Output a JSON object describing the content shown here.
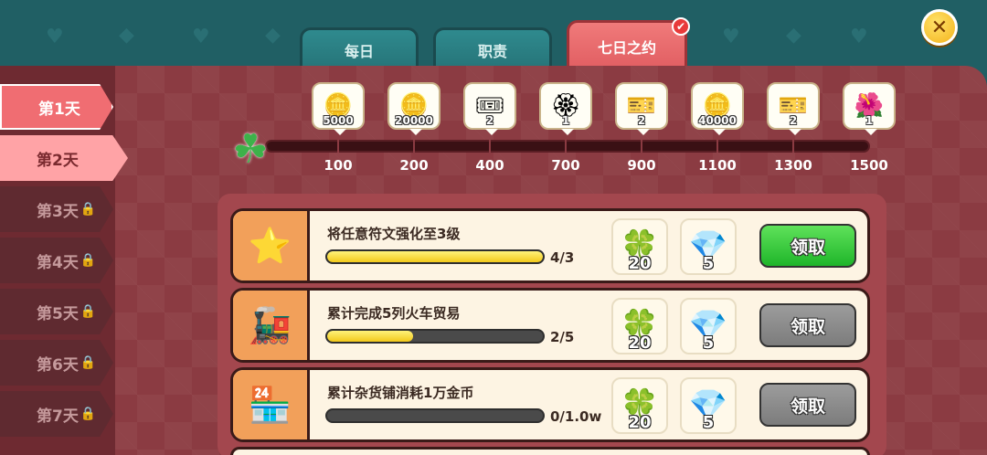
{
  "tabs": [
    {
      "label": "每日",
      "active": false
    },
    {
      "label": "职责",
      "active": false
    },
    {
      "label": "七日之约",
      "active": true,
      "badge": "✔"
    }
  ],
  "close_icon": "✕",
  "days": [
    {
      "label": "第1天",
      "state": "unlocked"
    },
    {
      "label": "第2天",
      "state": "selected"
    },
    {
      "label": "第3天",
      "state": "locked"
    },
    {
      "label": "第4天",
      "state": "locked"
    },
    {
      "label": "第5天",
      "state": "locked"
    },
    {
      "label": "第6天",
      "state": "locked"
    },
    {
      "label": "第7天",
      "state": "locked"
    }
  ],
  "lock_icon": "🔒",
  "milestones": [
    {
      "value": "100",
      "reward_icon": "🪙",
      "reward_count": "5000"
    },
    {
      "value": "200",
      "reward_icon": "🪙",
      "reward_count": "20000"
    },
    {
      "value": "400",
      "reward_icon": "🎟",
      "reward_count": "2"
    },
    {
      "value": "700",
      "reward_icon": "🏵",
      "reward_count": "1"
    },
    {
      "value": "900",
      "reward_icon": "🎫",
      "reward_count": "2"
    },
    {
      "value": "1100",
      "reward_icon": "🪙",
      "reward_count": "40000"
    },
    {
      "value": "1300",
      "reward_icon": "🎫",
      "reward_count": "2"
    },
    {
      "value": "1500",
      "reward_icon": "🌺",
      "reward_count": "1"
    }
  ],
  "progress_icon": "☘",
  "tasks": [
    {
      "thumb_icon": "⭐",
      "title": "将任意符文强化至3级",
      "progress_text": "4/3",
      "progress": 1.0,
      "reward1_icon": "🍀",
      "reward1_count": "20",
      "reward2_icon": "💎",
      "reward2_count": "5",
      "button_label": "领取",
      "button_state": "green"
    },
    {
      "thumb_icon": "🚂",
      "title": "累计完成5列火车贸易",
      "progress_text": "2/5",
      "progress": 0.4,
      "reward1_icon": "🍀",
      "reward1_count": "20",
      "reward2_icon": "💎",
      "reward2_count": "5",
      "button_label": "领取",
      "button_state": "gray"
    },
    {
      "thumb_icon": "🏪",
      "title": "累计杂货铺消耗1万金币",
      "progress_text": "0/1.0w",
      "progress": 0.0,
      "reward1_icon": "🍀",
      "reward1_count": "20",
      "reward2_icon": "💎",
      "reward2_count": "5",
      "button_label": "领取",
      "button_state": "gray"
    }
  ]
}
